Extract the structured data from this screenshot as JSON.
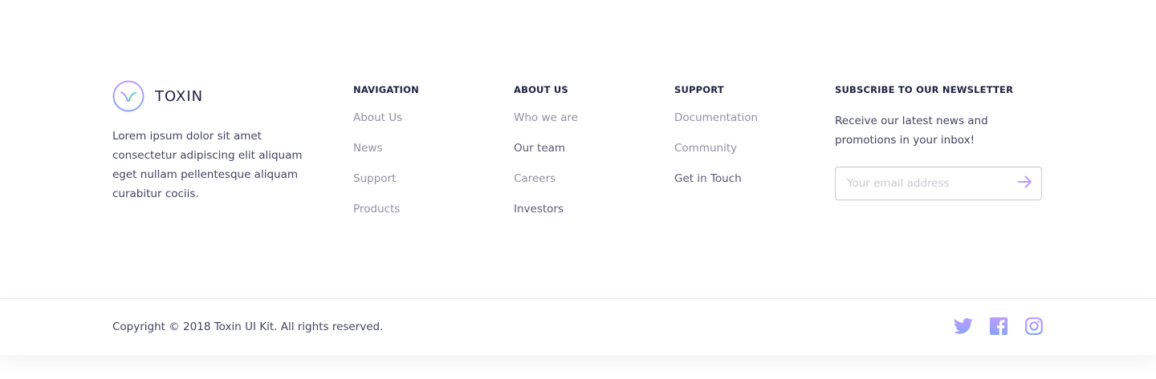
{
  "brand": {
    "name": "TOXIN",
    "description": "Lorem ipsum dolor sit amet consectetur adipiscing elit aliquam eget nullam pellentesque aliquam curabitur cociis.",
    "logo_icon": "toxin-logo-icon",
    "colors": {
      "gradient_start": "#BC9CFF",
      "gradient_end": "#6FCF97"
    }
  },
  "navigation": {
    "heading": "NAVIGATION",
    "items": [
      "About Us",
      "News",
      "Support",
      "Products"
    ]
  },
  "about": {
    "heading": "ABOUT US",
    "items": [
      "Who we are",
      "Our team",
      "Careers",
      "Investors"
    ]
  },
  "support": {
    "heading": "SUPPORT",
    "items": [
      "Documentation",
      "Community",
      "Get in Touch"
    ]
  },
  "newsletter": {
    "heading": "SUBSCRIBE TO OUR NEWSLETTER",
    "text": "Receive our latest news and promotions in your inbox!",
    "placeholder": "Your email address",
    "submit_icon": "arrow-right-icon",
    "accent": "#BC9CFF"
  },
  "bottom": {
    "copyright": "Copyright © 2018 Toxin UI Kit. All rights reserved.",
    "socials": [
      "twitter-icon",
      "facebook-icon",
      "instagram-icon"
    ]
  }
}
